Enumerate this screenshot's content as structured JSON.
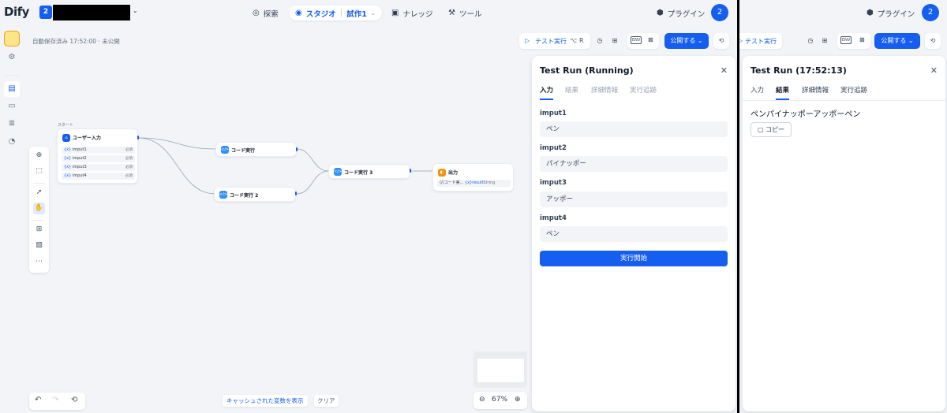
{
  "app": {
    "logo": "Dify",
    "workspace_badge": "2"
  },
  "nav": {
    "explore": "探索",
    "studio": "スタジオ",
    "studio_app": "試作1",
    "knowledge": "ナレッジ",
    "tools": "ツール",
    "plugins": "プラグイン",
    "avatar": "2"
  },
  "autosave": "自動保存済み 17:52:00 · 未公開",
  "toolbar": {
    "test_run": "テスト実行",
    "shortcut_alt": "⌥",
    "shortcut_key": "R",
    "env": "ENV",
    "publish": "公開する"
  },
  "nodes": {
    "start_label": "スタート",
    "user_input": "ユーザー入力",
    "vars": [
      {
        "name": "imput1",
        "tag": "必須"
      },
      {
        "name": "imput2",
        "tag": "必須"
      },
      {
        "name": "imput3",
        "tag": "必須"
      },
      {
        "name": "imput4",
        "tag": "必須"
      }
    ],
    "var_prefix": "{x}",
    "code1": "コード実行",
    "code2": "コード実行 2",
    "code3": "コード実行 3",
    "output": "出力",
    "output_row_src": "⟨/⟩コード実...",
    "output_row_var": "{x}result",
    "output_row_type": "String"
  },
  "bottom": {
    "cache_button": "キャッシュされた変数を表示",
    "clear_button": "クリア",
    "zoom": "67%"
  },
  "panel_run": {
    "title": "Test Run (Running)",
    "tabs": [
      "入力",
      "結果",
      "詳細情報",
      "実行追跡"
    ],
    "fields": [
      {
        "label": "imput1",
        "value": "ペン"
      },
      {
        "label": "imput2",
        "value": "パイナッポー"
      },
      {
        "label": "imput3",
        "value": "アッポー"
      },
      {
        "label": "imput4",
        "value": "ペン"
      }
    ],
    "run_button": "実行開始"
  },
  "panel_result": {
    "title": "Test Run (17:52:13)",
    "tabs": [
      "入力",
      "結果",
      "詳細情報",
      "実行追跡"
    ],
    "result": "ペンパイナッポーアッポーペン",
    "copy_button": "コピー"
  },
  "colors": {
    "accent": "#155eef",
    "canvas": "#f2f4f7"
  }
}
